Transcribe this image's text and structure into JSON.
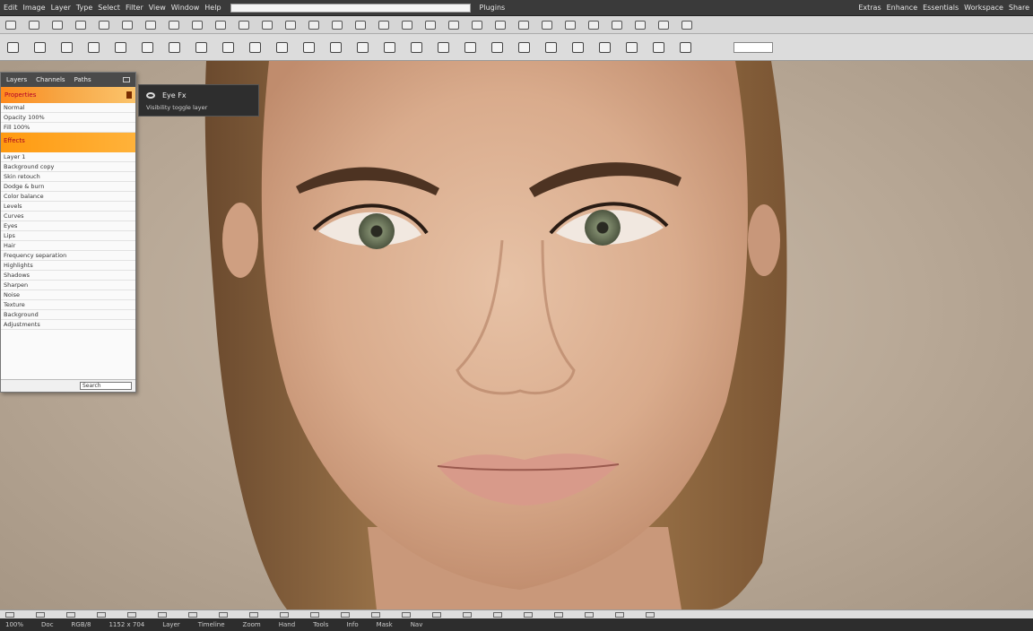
{
  "menubar": {
    "items": [
      "Edit",
      "Image",
      "Layer",
      "Type",
      "Select",
      "Filter",
      "View",
      "Window",
      "Help",
      "Plugins",
      "Extras",
      "Enhance"
    ],
    "right_items": [
      "Essentials",
      "Workspace",
      "Share"
    ]
  },
  "layers_panel": {
    "tabs": [
      "Layers",
      "Channels",
      "Paths"
    ],
    "orange_bar_label": "Properties",
    "group_label": "Effects",
    "rows_a": [
      "Normal",
      "Opacity 100%",
      "Fill 100%"
    ],
    "rows_b": [
      "Layer 1",
      "Background copy",
      "Skin retouch",
      "Dodge & burn",
      "Color balance",
      "Levels",
      "Curves",
      "Eyes",
      "Lips",
      "Hair",
      "Frequency separation",
      "Highlights",
      "Shadows",
      "Sharpen",
      "Noise",
      "Texture",
      "Background",
      "Adjustments"
    ],
    "footer_field": "Search"
  },
  "overlay": {
    "title": "Eye Fx",
    "subtitle": "Visibility toggle layer"
  },
  "statusbar_items": 22,
  "bottombar": {
    "items": [
      "100%",
      "Doc",
      "RGB/8",
      "1152 x 704",
      "Layer",
      "Timeline",
      "Zoom",
      "Hand",
      "Tools",
      "Info",
      "Mask",
      "Nav"
    ]
  },
  "colors": {
    "accent": "#ff9a10",
    "panel_label": "#a60020",
    "chrome_dark": "#3a3a3a",
    "chrome_light": "#dcdcdc"
  },
  "icons": {
    "tools": [
      "move-icon",
      "marquee-icon",
      "lasso-icon",
      "crop-icon",
      "eyedropper-icon",
      "brush-icon",
      "clone-icon",
      "eraser-icon",
      "gradient-icon",
      "blur-icon",
      "dodge-icon",
      "pen-icon",
      "type-icon",
      "shape-icon",
      "hand-icon",
      "zoom-icon",
      "settings-icon",
      "layers-icon",
      "history-icon",
      "adjust-icon",
      "mask-icon",
      "filter-icon",
      "info-icon",
      "swatch-icon",
      "color-icon",
      "brush-preset-icon",
      "grid-icon",
      "ruler-icon",
      "share-icon",
      "export-icon"
    ]
  }
}
